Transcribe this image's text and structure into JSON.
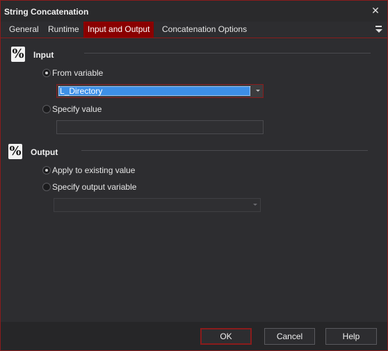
{
  "window": {
    "title": "String Concatenation"
  },
  "tabs": [
    {
      "label": "General"
    },
    {
      "label": "Runtime"
    },
    {
      "label": "Input and Output",
      "active": true
    },
    {
      "label": "Concatenation Options"
    }
  ],
  "input_section": {
    "title": "Input",
    "icon": "percent-icon",
    "from_variable_label": "From variable",
    "from_variable_checked": true,
    "variable_value": "L_Directory",
    "specify_value_label": "Specify value",
    "specify_value_checked": false,
    "specify_value_text": ""
  },
  "output_section": {
    "title": "Output",
    "icon": "percent-icon",
    "apply_existing_label": "Apply to existing value",
    "apply_existing_checked": true,
    "specify_output_label": "Specify output variable",
    "specify_output_checked": false,
    "output_variable_value": ""
  },
  "footer": {
    "ok_label": "OK",
    "cancel_label": "Cancel",
    "help_label": "Help"
  },
  "colors": {
    "accent": "#8a0000",
    "selection": "#3d8fe6",
    "background": "#2d2d30"
  }
}
